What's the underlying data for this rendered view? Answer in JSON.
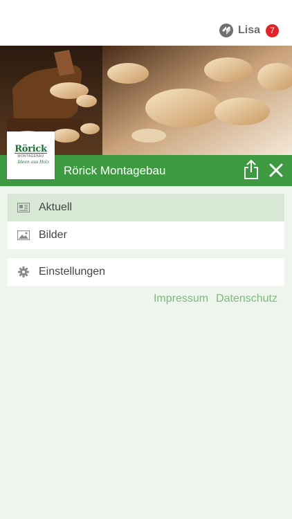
{
  "header": {
    "user_name": "Lisa",
    "notification_count": "7",
    "icon": "app-logo-icon"
  },
  "brand": {
    "logo_name": "Rörick",
    "logo_subtitle": "MONTAGEBAU",
    "logo_tagline": "Ideen aus Holz",
    "title": "Rörick Montagebau"
  },
  "menu": {
    "primary": [
      {
        "label": "Aktuell",
        "icon": "news-icon",
        "active": true
      },
      {
        "label": "Bilder",
        "icon": "image-icon",
        "active": false
      }
    ],
    "secondary": [
      {
        "label": "Einstellungen",
        "icon": "gear-icon",
        "active": false
      }
    ]
  },
  "footer_links": [
    "Impressum",
    "Datenschutz"
  ],
  "colors": {
    "brand_green": "#3d9a40",
    "active_item": "#d7e9d5",
    "background": "#eef5ec",
    "badge_red": "#e0232b",
    "link_green": "#7fb87d"
  }
}
